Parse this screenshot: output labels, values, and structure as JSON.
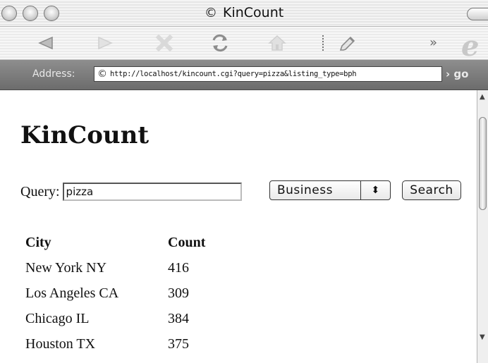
{
  "window": {
    "title": "KinCount",
    "title_icon": "©"
  },
  "toolbar": {
    "buttons": [
      "back-icon",
      "forward-icon",
      "stop-icon",
      "refresh-icon",
      "home-icon",
      "autofill-icon"
    ],
    "overflow": "»",
    "logo": "e"
  },
  "address_bar": {
    "label": "Address:",
    "icon": "©",
    "url": "http://localhost/kincount.cgi?query=pizza&listing_type=bph",
    "go_label": "› go"
  },
  "page": {
    "heading": "KinCount",
    "query_label": "Query:",
    "query_value": "pizza",
    "listing_type": "Business",
    "select_arrows": "⬍",
    "search_label": "Search",
    "table": {
      "headers": [
        "City",
        "Count"
      ],
      "rows": [
        [
          "New York NY",
          "416"
        ],
        [
          "Los Angeles CA",
          "309"
        ],
        [
          "Chicago IL",
          "384"
        ],
        [
          "Houston TX",
          "375"
        ]
      ]
    }
  }
}
